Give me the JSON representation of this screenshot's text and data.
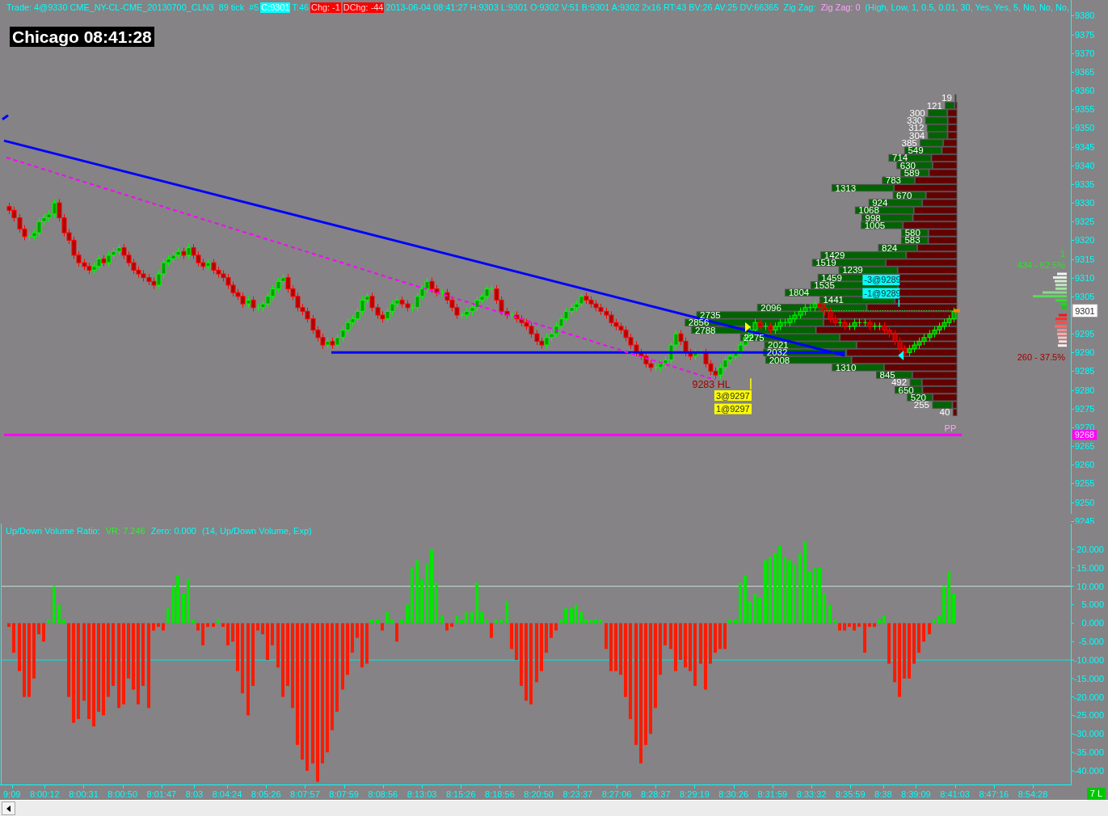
{
  "header": {
    "segments": [
      {
        "kind": "text",
        "text": "Trade: 4@9330 CME_NY-CL-CME_20130700_CLN3  89 tick  #5"
      },
      {
        "kind": "cyan_tag",
        "text": "C:9301"
      },
      {
        "kind": "text",
        "text": "T:46"
      },
      {
        "kind": "red_tag",
        "text": "Chg: -1"
      },
      {
        "kind": "red_tag",
        "text": "DChg: -44"
      },
      {
        "kind": "text",
        "text": "2013-06-04 08:41:27 H:9303 L:9301 O:9302 V:51 B:9301 A:9302 2x16 RT:43 BV:26 AV:25 DV:66365  Zig Zag:"
      },
      {
        "kind": "magenta_text",
        "text": "Zig Zag: 0"
      },
      {
        "kind": "text",
        "text": "(High, Low, 1, 0.5, 0.01, 30, Yes, Yes, 5, No, No, No,"
      }
    ]
  },
  "clock": "Chicago 08:41:28",
  "price_panel": {
    "price_axis": {
      "labels": [
        "9380",
        "9375",
        "9370",
        "9365",
        "9360",
        "9355",
        "9350",
        "9345",
        "9340",
        "9335",
        "9330",
        "9325",
        "9320",
        "9315",
        "9310",
        "9305",
        "9295",
        "9290",
        "9285",
        "9280",
        "9275",
        "9270",
        "9265",
        "9260",
        "9255",
        "9250",
        "9245"
      ]
    },
    "low_label": "9283 HL",
    "pivot": {
      "label": "PP",
      "tag": "9268"
    },
    "last_price_tag": "9301",
    "fills": [
      {
        "kind": "buy",
        "labels": [
          "3@9297",
          "1@9297"
        ]
      },
      {
        "kind": "sell",
        "labels": [
          "-3@9289",
          "-1@9289"
        ]
      }
    ],
    "volume_profile": {
      "labels": [
        "19",
        "121",
        "300",
        "330",
        "312",
        "304",
        "385",
        "549",
        "714",
        "630",
        "589",
        "783",
        "1313",
        "670",
        "924",
        "1068",
        "998",
        "1005",
        "580",
        "583",
        "824",
        "1429",
        "1519",
        "1239",
        "1459",
        "1535",
        "1804",
        "1441",
        "2096",
        "2735",
        "2856",
        "2788",
        "2275",
        "2021",
        "2032",
        "2008",
        "1310",
        "845",
        "492",
        "650",
        "520",
        "255",
        "40"
      ]
    },
    "ladder": {
      "count": "1",
      "buy_summary": "434 - 62.5%",
      "sell_summary": "260 - 37.5%"
    }
  },
  "indicator_panel": {
    "title_segments": [
      {
        "kind": "label",
        "text": "Up/Down Volume Ratio:"
      },
      {
        "kind": "value",
        "text": "VR: 7.246"
      },
      {
        "kind": "label",
        "text": "Zero: 0.000"
      },
      {
        "kind": "label",
        "text": "(14, Up/Down Volume, Exp)"
      }
    ],
    "chart_data": {
      "type": "bar",
      "categories": [
        null,
        null,
        null,
        null,
        null,
        null,
        null,
        null,
        null,
        null,
        null,
        null,
        null,
        null,
        null,
        null,
        null,
        null,
        null,
        null,
        null,
        null,
        null,
        null,
        null,
        null,
        null,
        null,
        null,
        null,
        null,
        null,
        null,
        null,
        null,
        null,
        null,
        null,
        null,
        null,
        null,
        null,
        null,
        null,
        null,
        null,
        null,
        null,
        null,
        null,
        null,
        null,
        null,
        null,
        null,
        null,
        null,
        null,
        null,
        null,
        null,
        null,
        null,
        null,
        null,
        null,
        null,
        null,
        null,
        null,
        null,
        null,
        null,
        null,
        null,
        null,
        null,
        null,
        null,
        null,
        null,
        null,
        null,
        null,
        null,
        null,
        null,
        null,
        null,
        null,
        null,
        null,
        null,
        null,
        null,
        null,
        null,
        null,
        null,
        null,
        null,
        null,
        null,
        null,
        null,
        null,
        null,
        null,
        null,
        null,
        null,
        null,
        null,
        null,
        null,
        null,
        null,
        null,
        null,
        null,
        null,
        null,
        null,
        null,
        null,
        null,
        null,
        null,
        null,
        null,
        null,
        null,
        null,
        null,
        null,
        null,
        null,
        null,
        null,
        null,
        null,
        null,
        null,
        null,
        null,
        null,
        null,
        null,
        null,
        null,
        null,
        null,
        null,
        null,
        null,
        null,
        null,
        null,
        null,
        null,
        null,
        null,
        null,
        null,
        null,
        null,
        null,
        null,
        null,
        null,
        null,
        null,
        null,
        null,
        null,
        null,
        null,
        null,
        null,
        null,
        null,
        null,
        null,
        null,
        null,
        null,
        null,
        null,
        null,
        null,
        null,
        null,
        null,
        null,
        null,
        null,
        null,
        null,
        null,
        null,
        null,
        null,
        null,
        null,
        null,
        null,
        null,
        null,
        null,
        null,
        null,
        null,
        null,
        null,
        null
      ],
      "ylim": [
        -43.94,
        27.0
      ],
      "yticks": [
        {
          "value": 20,
          "label": "20.000"
        },
        {
          "value": 15,
          "label": "15.000"
        },
        {
          "value": 10,
          "label": "10.000"
        },
        {
          "value": 5,
          "label": "5.000"
        },
        {
          "value": 0,
          "label": "0.000"
        },
        {
          "value": -5,
          "label": "-5.000"
        },
        {
          "value": -10,
          "label": "-10.000"
        },
        {
          "value": -15,
          "label": "-15.000"
        },
        {
          "value": -20,
          "label": "-20.000"
        },
        {
          "value": -25,
          "label": "-25.000"
        },
        {
          "value": -30,
          "label": "-30.000"
        },
        {
          "value": -35,
          "label": "-35.000"
        },
        {
          "value": -40,
          "label": "-40.000"
        }
      ],
      "ref_lines": [
        {
          "axis": "y",
          "value": 10
        },
        {
          "axis": "y",
          "value": -10
        }
      ],
      "values": [
        null,
        -1,
        -8,
        -13,
        -20,
        -20,
        -15,
        -3,
        -5,
        1,
        10,
        5,
        1,
        -20,
        -27,
        -26,
        -21,
        -26,
        -28,
        -24,
        -25,
        -20,
        -17,
        -23,
        -22,
        -15,
        -18,
        -22,
        -17,
        -23,
        -2,
        -1,
        -2,
        4,
        10,
        13,
        8,
        12,
        1,
        -2,
        -6,
        -1,
        -1,
        1,
        -1,
        -6,
        -5,
        -13,
        -19,
        -25,
        -17,
        -2,
        -3,
        -10,
        -6,
        -12,
        -20,
        -17,
        -23,
        -33,
        -37,
        -40,
        -38,
        -43,
        -38,
        -35,
        -29,
        -24,
        -18,
        -14,
        -8,
        -4,
        -12,
        -11,
        1,
        1,
        -2,
        3,
        1,
        -5,
        1,
        5,
        15,
        17,
        12,
        16,
        20,
        11,
        2,
        -2,
        -1,
        2,
        1,
        3,
        3,
        11,
        3,
        1,
        -4,
        1,
        1,
        6,
        -7,
        -10,
        -17,
        -21,
        -22,
        -16,
        -13,
        -8,
        -4,
        -2,
        1,
        4,
        4,
        5,
        3,
        1,
        1,
        1,
        1,
        -7,
        -13,
        -13,
        -14,
        -20,
        -26,
        -33,
        -38,
        -33,
        -30,
        -23,
        -14,
        -6,
        -7,
        -13,
        -10,
        -12,
        -13,
        -17,
        -11,
        -18,
        -11,
        -8,
        -7,
        -7,
        1,
        1,
        11,
        13,
        6,
        8,
        7,
        17,
        18,
        19,
        21,
        18,
        17,
        16,
        19,
        22,
        14,
        15,
        15,
        8,
        5,
        1,
        -2,
        -2,
        -1,
        -2,
        -1,
        -8,
        -1,
        -1,
        1,
        2,
        -11,
        -16,
        -20,
        -15,
        -15,
        -11,
        -8,
        -5,
        -3,
        1,
        2,
        10,
        14,
        8,
        null,
        null,
        null,
        null,
        null,
        null,
        null,
        null,
        null,
        null,
        null,
        null,
        null,
        null,
        null,
        null,
        null,
        null,
        null,
        null,
        null,
        null,
        null
      ]
    }
  },
  "time_axis": {
    "labels": [
      "9:09",
      "8:00:12",
      "8:00:31",
      "8:00:50",
      "8:01:47",
      "8:03",
      "8:04:24",
      "8:05:26",
      "8:07:57",
      "8:07:59",
      "8:08:56",
      "8:13:03",
      "8:15:26",
      "8:18:56",
      "8:20:50",
      "8:23:37",
      "8:27:06",
      "8:28:37",
      "8:29:19",
      "8:30:26",
      "8:31:59",
      "8:33:32",
      "8:35:59",
      "8:38",
      "8:39:09",
      "8:41:03",
      "8:47:16",
      "8:54:28"
    ]
  },
  "status_tag": "7 L"
}
